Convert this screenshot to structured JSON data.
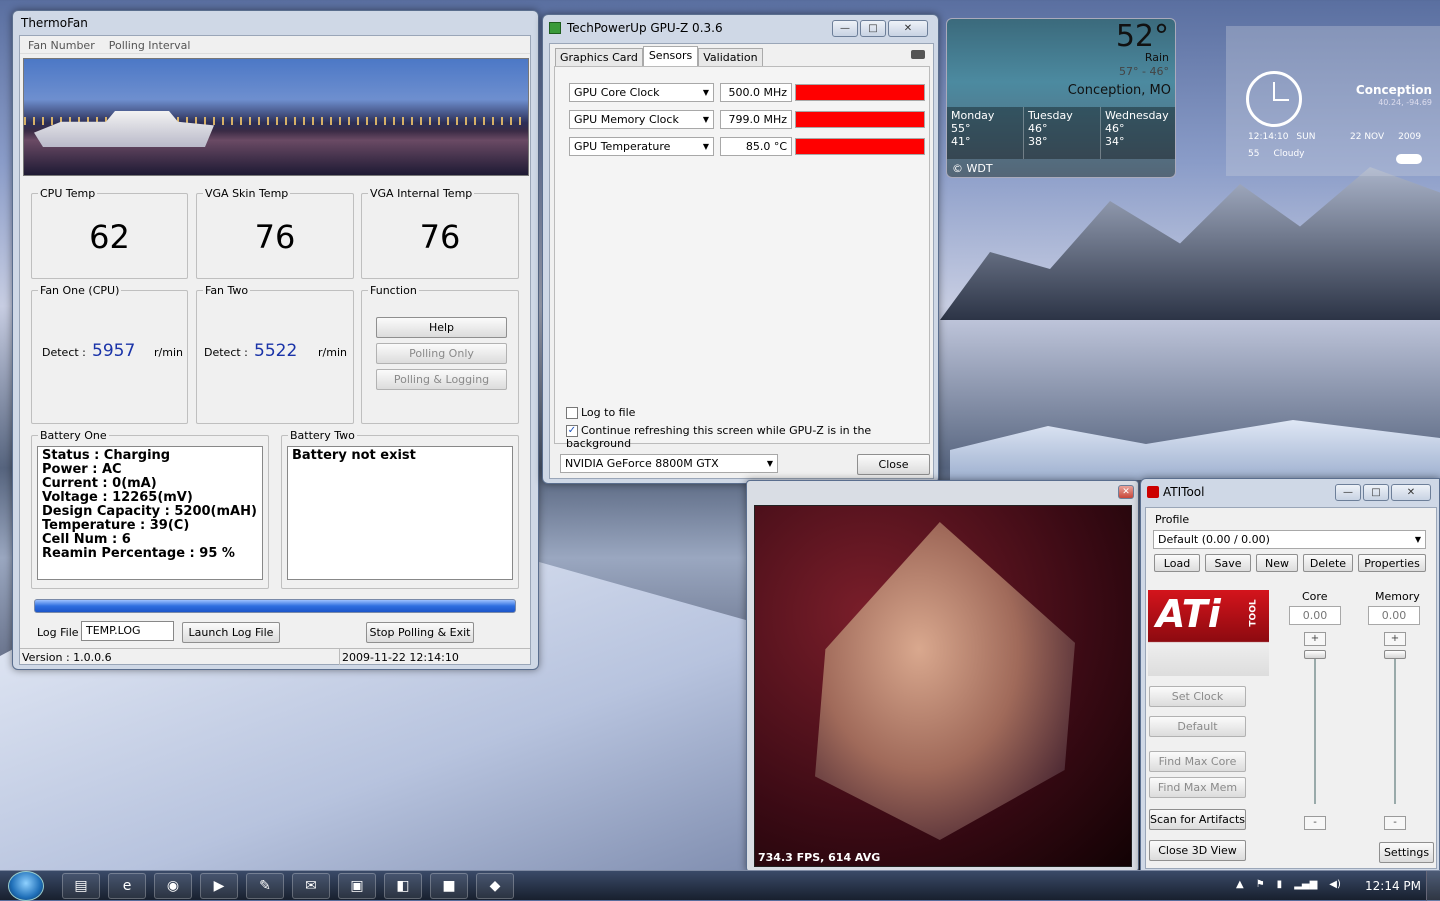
{
  "thermofan": {
    "title": "ThermoFan",
    "menu": [
      "Fan Number",
      "Polling Interval"
    ],
    "cpu_temp_label": "CPU Temp",
    "cpu_temp": "62",
    "vga_skin_label": "VGA Skin Temp",
    "vga_skin": "76",
    "vga_internal_label": "VGA Internal Temp",
    "vga_internal": "76",
    "fan_one_label": "Fan One (CPU)",
    "fan_two_label": "Fan Two",
    "function_label": "Function",
    "detect_label": "Detect :",
    "fan_one_rpm": "5957",
    "fan_two_rpm": "5522",
    "rpm_unit": "r/min",
    "help": "Help",
    "polling_only": "Polling Only",
    "polling_logging": "Polling & Logging",
    "battery_one_label": "Battery One",
    "battery_two_label": "Battery Two",
    "battery_one_text": "Status : Charging\nPower : AC\nCurrent : 0(mA)\nVoltage : 12265(mV)\nDesign Capacity : 5200(mAH)\nTemperature : 39(C)\nCell Num : 6\nReamin Percentage : 95 %",
    "battery_two_text": "Battery not exist",
    "log_file_label": "Log File",
    "log_file_value": "TEMP.LOG",
    "launch_log": "Launch Log File",
    "stop_polling": "Stop Polling & Exit",
    "version": "Version : 1.0.0.6",
    "timestamp": "2009-11-22 12:14:10"
  },
  "gpuz": {
    "title": "TechPowerUp GPU-Z 0.3.6",
    "tabs": [
      "Graphics Card",
      "Sensors",
      "Validation"
    ],
    "sensors": [
      {
        "name": "GPU Core Clock",
        "value": "500.0 MHz"
      },
      {
        "name": "GPU Memory Clock",
        "value": "799.0 MHz"
      },
      {
        "name": "GPU Temperature",
        "value": "85.0 °C"
      }
    ],
    "log_to_file": "Log to file",
    "continue_refresh": "Continue refreshing this screen while GPU-Z is in the background",
    "card": "NVIDIA GeForce 8800M GTX",
    "close": "Close"
  },
  "weather": {
    "temp": "52°",
    "condition": "Rain",
    "hilo": "57° - 46°",
    "location": "Conception, MO",
    "days": [
      {
        "day": "Monday",
        "hi": "55°",
        "lo": "41°"
      },
      {
        "day": "Tuesday",
        "hi": "46°",
        "lo": "38°"
      },
      {
        "day": "Wednesday",
        "hi": "46°",
        "lo": "34°"
      }
    ],
    "credit": "© WDT"
  },
  "clock_gadget": {
    "city": "Conception",
    "coords": "40.24, -94.69",
    "time": "12:14:10",
    "dow": "SUN",
    "date": "22 NOV",
    "year": "2009",
    "temp": "55",
    "cond": "Cloudy"
  },
  "render3d": {
    "fps": "734.3 FPS, 614 AVG"
  },
  "atitool": {
    "title": "ATITool",
    "profile_label": "Profile",
    "profile_value": "Default (0.00 / 0.00)",
    "buttons": [
      "Load",
      "Save",
      "New",
      "Delete",
      "Properties"
    ],
    "core_label": "Core",
    "memory_label": "Memory",
    "core_value": "0.00",
    "memory_value": "0.00",
    "logo_text": "ATi",
    "logo_sub": "TOOL",
    "set_clock": "Set Clock",
    "default": "Default",
    "find_max_core": "Find Max Core",
    "find_max_mem": "Find Max Mem",
    "scan_artifacts": "Scan for Artifacts",
    "close_3d": "Close 3D View",
    "settings": "Settings"
  },
  "taskbar": {
    "time": "12:14 PM"
  }
}
